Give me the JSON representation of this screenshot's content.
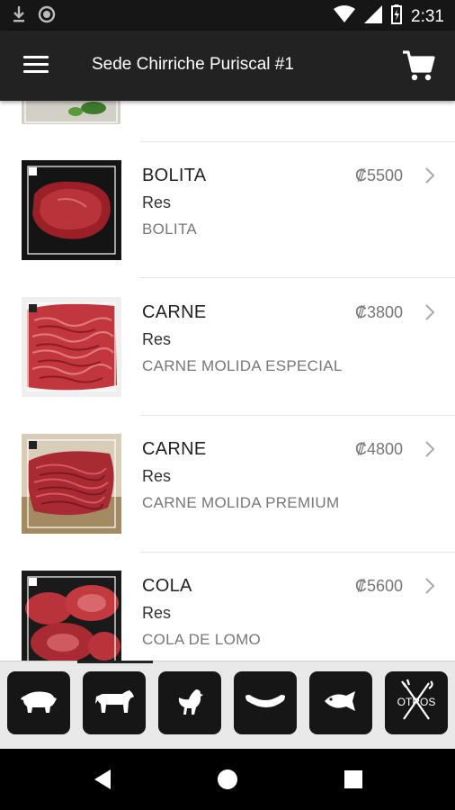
{
  "status_bar": {
    "time": "2:31",
    "icons": [
      "download-icon",
      "circle-notification-icon",
      "wifi-icon",
      "signal-icon",
      "battery-icon"
    ]
  },
  "app_bar": {
    "title": "Sede Chirriche Puriscal #1",
    "menu_icon": "hamburger-menu-icon",
    "cart_icon": "shopping-cart-icon"
  },
  "products": [
    {
      "name": "BOLITA",
      "category": "Res",
      "description": "BOLITA",
      "price": "₡5500"
    },
    {
      "name": "CARNE",
      "category": "Res",
      "description": "CARNE MOLIDA ESPECIAL",
      "price": "₡3800"
    },
    {
      "name": "CARNE",
      "category": "Res",
      "description": "CARNE MOLIDA PREMIUM",
      "price": "₡4800"
    },
    {
      "name": "COLA",
      "category": "Res",
      "description": "COLA DE LOMO",
      "price": "₡5600"
    }
  ],
  "categories": [
    {
      "icon": "pig-icon"
    },
    {
      "icon": "cow-icon"
    },
    {
      "icon": "chicken-icon"
    },
    {
      "icon": "sausage-icon"
    },
    {
      "icon": "fish-icon"
    },
    {
      "icon": "otros-utensils-icon",
      "label": "OTROS"
    }
  ],
  "colors": {
    "app_bar": "#222222",
    "status_bar": "#161616",
    "category_button": "#161616",
    "meat": "#a8242c"
  }
}
